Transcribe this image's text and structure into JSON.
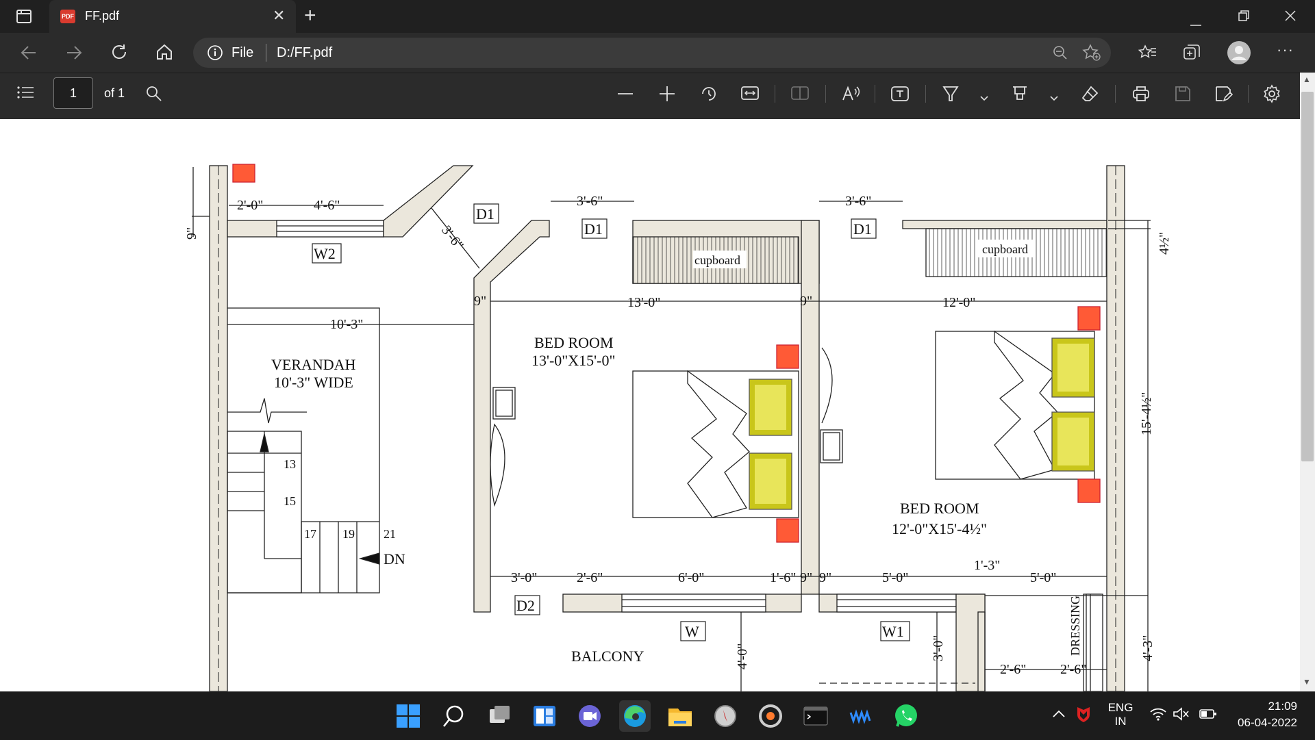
{
  "browser": {
    "tab_title": "FF.pdf",
    "tab_badge": "PDF",
    "address_label": "File",
    "url": "D:/FF.pdf"
  },
  "pdf_toolbar": {
    "page_number": "1",
    "page_total": "of 1"
  },
  "plan": {
    "dims": {
      "w2_left": "2'-0\"",
      "w2_right": "4'-6\"",
      "top_left_9": "9\"",
      "diag": "3'-6\"",
      "d1_top_a": "3'-6\"",
      "d1_top_b": "3'-6\"",
      "right_top": "4½\"",
      "room1_width": "13'-0\"",
      "room2_width": "12'-0\"",
      "nine_a": "9\"",
      "nine_b": "9\"",
      "verandah_w": "10'-3\"",
      "right_height": "15'-4½\"",
      "b1": "3'-0\"",
      "b2": "2'-6\"",
      "b3": "6'-0\"",
      "b4": "1'-6\"",
      "b5": "9\"",
      "b6": "9\"",
      "b7": "5'-0\"",
      "b8": "1'-3\"",
      "b9": "5'-0\"",
      "v4": "4'-0\"",
      "v3": "3'-0\"",
      "v43": "4'-3\"",
      "d26a": "2'-6\"",
      "d26b": "2'-6\""
    },
    "tags": {
      "d1_a": "D1",
      "d1_b": "D1",
      "d1_c": "D1",
      "w2": "W2",
      "d2": "D2",
      "w": "W",
      "w1": "W1"
    },
    "labels": {
      "cupboard_a": "cupboard",
      "cupboard_b": "cupboard",
      "bed1_name": "BED ROOM",
      "bed1_size": "13'-0\"X15'-0\"",
      "bed2_name": "BED ROOM",
      "bed2_size": "12'-0\"X15'-4½\"",
      "verandah_name": "VERANDAH",
      "verandah_width": "10'-3\" WIDE",
      "balcony": "BALCONY",
      "dressing": "DRESSING",
      "dn": "DN",
      "s13": "13",
      "s15": "15",
      "s17": "17",
      "s19": "19",
      "s21": "21"
    }
  },
  "taskbar": {
    "language": "ENG",
    "region": "IN",
    "time": "21:09",
    "date": "06-04-2022"
  },
  "colors": {
    "wall": "#ebe7dc",
    "accent_red": "#ff5a36",
    "pillow": "#c9c61a"
  }
}
